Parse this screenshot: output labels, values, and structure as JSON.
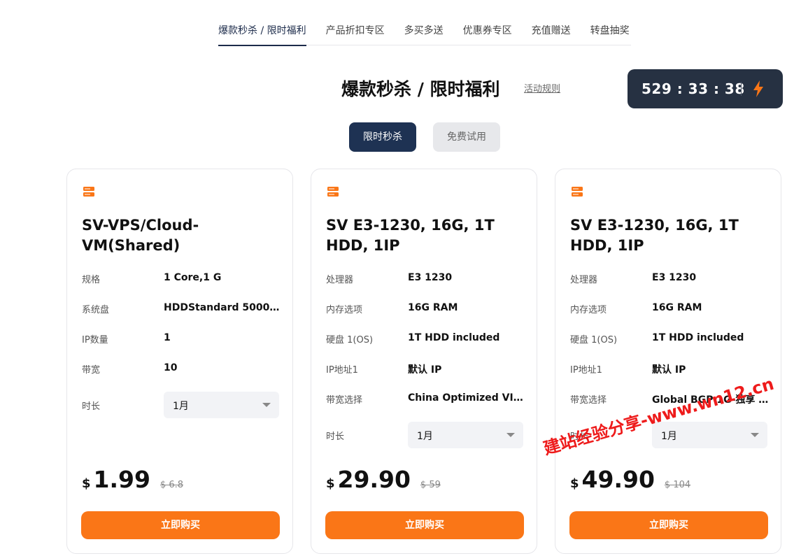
{
  "tabs": [
    {
      "label": "爆款秒杀 / 限时福利",
      "active": true
    },
    {
      "label": "产品折扣专区",
      "active": false
    },
    {
      "label": "多买多送",
      "active": false
    },
    {
      "label": "优惠券专区",
      "active": false
    },
    {
      "label": "充值赠送",
      "active": false
    },
    {
      "label": "转盘抽奖",
      "active": false
    }
  ],
  "header": {
    "title": "爆款秒杀 / 限时福利",
    "rules_link": "活动规则"
  },
  "countdown": {
    "time": "529 : 33 : 38",
    "icon": "lightning-bolt-icon"
  },
  "modes": {
    "primary": "限时秒杀",
    "secondary": "免费试用"
  },
  "colors": {
    "accent": "#fa7617",
    "navy": "#1e3253",
    "countdown_bg": "#263142"
  },
  "cards": [
    {
      "title": "SV-VPS/Cloud-VM(Shared)",
      "specs": [
        {
          "label": "规格",
          "value": "1 Core,1 G"
        },
        {
          "label": "系统盘",
          "value": "HDDStandard 5000I..."
        },
        {
          "label": "IP数量",
          "value": "1"
        },
        {
          "label": "带宽",
          "value": "10"
        }
      ],
      "duration_label": "时长",
      "duration": "1月",
      "currency": "$",
      "price": "1.99",
      "original_price": "$ 6.8",
      "buy_label": "立即购买"
    },
    {
      "title": "SV E3-1230, 16G, 1T HDD, 1IP",
      "specs": [
        {
          "label": "处理器",
          "value": "E3 1230"
        },
        {
          "label": "内存选项",
          "value": "16G RAM"
        },
        {
          "label": "硬盘 1(OS)",
          "value": "1T HDD included"
        },
        {
          "label": "IP地址1",
          "value": "默认 IP"
        },
        {
          "label": "带宽选择",
          "value": "China Optimized VIP ..."
        }
      ],
      "duration_label": "时长",
      "duration": "1月",
      "currency": "$",
      "price": "29.90",
      "original_price": "$ 59",
      "buy_label": "立即购买"
    },
    {
      "title": "SV E3-1230, 16G, 1T HDD, 1IP",
      "specs": [
        {
          "label": "处理器",
          "value": "E3 1230"
        },
        {
          "label": "内存选项",
          "value": "16G RAM"
        },
        {
          "label": "硬盘 1(OS)",
          "value": "1T HDD included"
        },
        {
          "label": "IP地址1",
          "value": "默认 IP"
        },
        {
          "label": "带宽选择",
          "value": "Global BGP 1G-独享 ..."
        }
      ],
      "duration_label": "时长",
      "duration": "1月",
      "currency": "$",
      "price": "49.90",
      "original_price": "$ 104",
      "buy_label": "立即购买"
    }
  ],
  "watermark": "建站经验分享-www.wn12.cn"
}
